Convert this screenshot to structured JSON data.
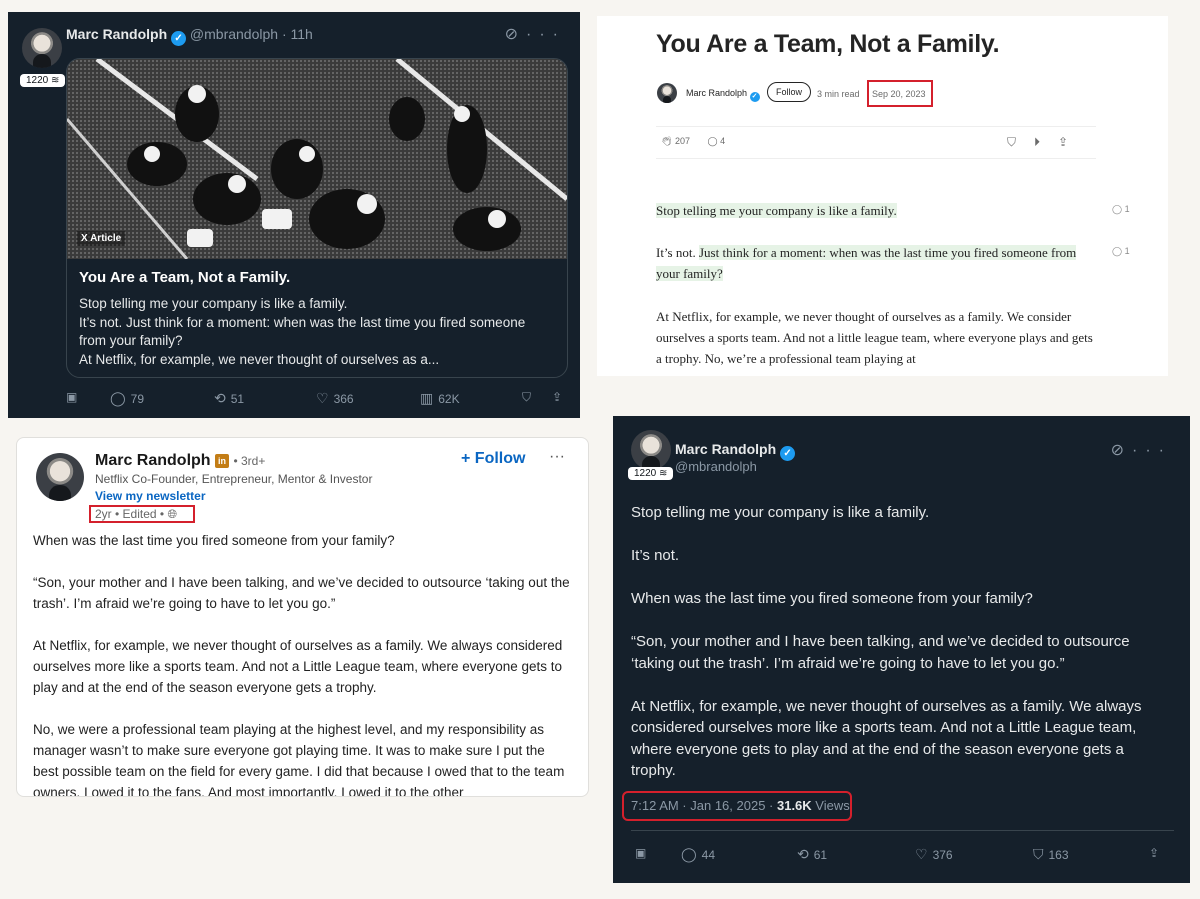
{
  "x_article": {
    "name": "Marc Randolph",
    "handle": "@mbrandolph",
    "time": "· 11h",
    "badge": "1220 ≋",
    "article_tag": "X Article",
    "title": "You Are a Team, Not a Family.",
    "body": [
      "Stop telling me your company is like a family.",
      "It’s not. Just think for a moment: when was the last time you fired someone from your family?",
      "At Netflix, for example, we never thought of ourselves as a..."
    ],
    "stats": {
      "replies": "79",
      "reposts": "51",
      "likes": "366",
      "views": "62K"
    }
  },
  "medium": {
    "title": "You Are a Team, Not a Family.",
    "author": "Marc Randolph",
    "follow": "Follow",
    "read_time": "3 min read",
    "date": "Sep 20, 2023",
    "claps": "207",
    "responses": "4",
    "para1": "Stop telling me your company is like a family.",
    "para2_plain": "It’s not. ",
    "para2_highlight": "Just think for a moment: when was the last time you fired someone from your family?",
    "para3": "At Netflix, for example, we never thought of ourselves as a family. We consider ourselves a sports team. And not a little league team, where everyone plays and gets a trophy. No, we’re a professional team playing at",
    "comment_count_1": "1",
    "comment_count_2": "1"
  },
  "linkedin": {
    "name": "Marc Randolph",
    "degree": "• 3rd+",
    "headline": "Netflix Co-Founder, Entrepreneur, Mentor & Investor",
    "newsletter": "View my newsletter",
    "time": "2yr • Edited •",
    "follow": "+ Follow",
    "paragraphs": [
      "When was the last time you fired someone from your family?",
      "“Son, your mother and I have been talking, and we’ve decided to outsource ‘taking out the trash’. I’m afraid we’re going to have to let you go.”",
      "At Netflix, for example, we never thought of ourselves as a family. We always considered ourselves more like a sports team. And not a Little League team, where everyone gets to play and at the end of the season everyone gets a trophy.",
      "No, we were a professional team playing at the highest level, and my responsibility as manager wasn’t to make sure everyone got playing time. It was to make sure I put the best possible team on the field for every game. I did that because I owed that to the team owners. I owed it to the fans. And most importantly, I owed it to the other"
    ]
  },
  "x_tweet": {
    "name": "Marc Randolph",
    "handle": "@mbrandolph",
    "badge": "1220 ≋",
    "paragraphs": [
      "Stop telling me your company is like a family.",
      "It’s not.",
      "When was the last time you fired someone from your family?",
      "“Son, your mother and I have been talking, and we’ve decided to outsource ‘taking out the trash’. I’m afraid we’re going to have to let you go.”",
      "At Netflix, for example, we never thought of ourselves as a family. We always considered ourselves more like a sports team. And not a Little League team, where everyone gets to play and at the end of the season everyone gets a trophy."
    ],
    "timestamp": "7:12 AM · Jan 16, 2025 · ",
    "views_count": "31.6K",
    "views_label": " Views",
    "stats": {
      "replies": "44",
      "reposts": "61",
      "likes": "376",
      "bookmarks": "163"
    }
  },
  "colors": {
    "x_bg": "#15202b",
    "verified": "#1d9bf0",
    "linkedin_blue": "#0a66c2",
    "medium_highlight": "#e6f3e6",
    "annotation_red": "#d4202c"
  },
  "icons": [
    "verified-icon",
    "grok-icon",
    "more-icon",
    "reply-icon",
    "repost-icon",
    "like-icon",
    "views-icon",
    "bookmark-icon",
    "share-icon",
    "clap-icon",
    "comment-icon",
    "play-icon",
    "globe-icon",
    "linkedin-premium-icon"
  ]
}
